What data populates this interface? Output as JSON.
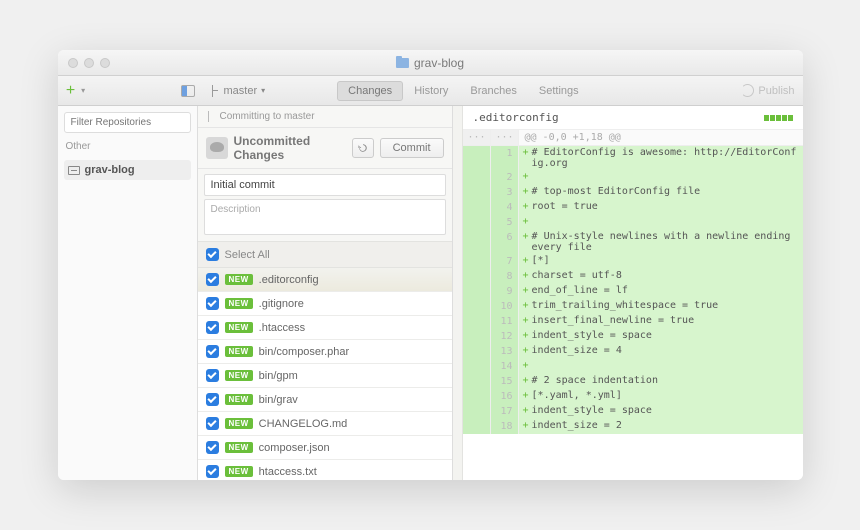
{
  "window": {
    "title": "grav-blog"
  },
  "toolbar": {
    "branch": "master",
    "tabs": {
      "changes": "Changes",
      "history": "History",
      "branches": "Branches",
      "settings": "Settings"
    },
    "publish": "Publish"
  },
  "sidebar": {
    "filter_placeholder": "Filter Repositories",
    "other_label": "Other",
    "repo": "grav-blog"
  },
  "commit_panel": {
    "committing_to": "Committing to master",
    "uncommitted_title": "Uncommitted Changes",
    "commit_btn": "Commit",
    "summary_value": "Initial commit",
    "description_placeholder": "Description",
    "select_all": "Select All",
    "new_badge": "NEW",
    "files": [
      ".editorconfig",
      ".gitignore",
      ".htaccess",
      "bin/composer.phar",
      "bin/gpm",
      "bin/grav",
      "CHANGELOG.md",
      "composer.json",
      "htaccess.txt"
    ]
  },
  "diff": {
    "filename": ".editorconfig",
    "hunk": "@@ -0,0 +1,18 @@",
    "lines": [
      {
        "n": 1,
        "t": "# EditorConfig is awesome: http://EditorConfig.org"
      },
      {
        "n": 2,
        "t": ""
      },
      {
        "n": 3,
        "t": "# top-most EditorConfig file"
      },
      {
        "n": 4,
        "t": "root = true"
      },
      {
        "n": 5,
        "t": ""
      },
      {
        "n": 6,
        "t": "# Unix-style newlines with a newline ending every file"
      },
      {
        "n": 7,
        "t": "[*]"
      },
      {
        "n": 8,
        "t": "charset = utf-8"
      },
      {
        "n": 9,
        "t": "end_of_line = lf"
      },
      {
        "n": 10,
        "t": "trim_trailing_whitespace = true"
      },
      {
        "n": 11,
        "t": "insert_final_newline = true"
      },
      {
        "n": 12,
        "t": "indent_style = space"
      },
      {
        "n": 13,
        "t": "indent_size = 4"
      },
      {
        "n": 14,
        "t": ""
      },
      {
        "n": 15,
        "t": "# 2 space indentation"
      },
      {
        "n": 16,
        "t": "[*.yaml, *.yml]"
      },
      {
        "n": 17,
        "t": "indent_style = space"
      },
      {
        "n": 18,
        "t": "indent_size = 2"
      }
    ]
  }
}
